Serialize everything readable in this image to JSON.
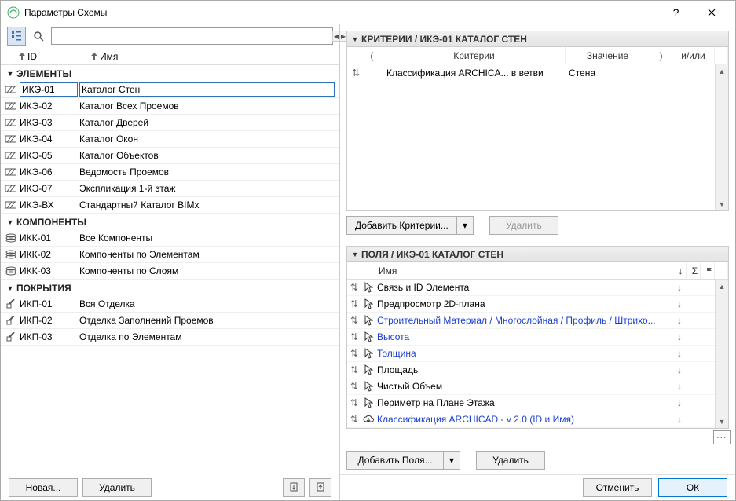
{
  "window": {
    "title": "Параметры Схемы"
  },
  "left": {
    "header": {
      "id": "ID",
      "name": "Имя"
    },
    "groups": [
      {
        "label": "ЭЛЕМЕНТЫ",
        "icon": "hatch",
        "items": [
          {
            "id": "ИКЭ-01",
            "name": "Каталог Стен",
            "selected": true
          },
          {
            "id": "ИКЭ-02",
            "name": "Каталог Всех Проемов"
          },
          {
            "id": "ИКЭ-03",
            "name": "Каталог Дверей"
          },
          {
            "id": "ИКЭ-04",
            "name": "Каталог Окон"
          },
          {
            "id": "ИКЭ-05",
            "name": "Каталог Объектов"
          },
          {
            "id": "ИКЭ-06",
            "name": "Ведомость Проемов"
          },
          {
            "id": "ИКЭ-07",
            "name": "Экспликация 1-й этаж"
          },
          {
            "id": "ИКЭ-ВХ",
            "name": "Стандартный Каталог BIMx"
          }
        ]
      },
      {
        "label": "КОМПОНЕНТЫ",
        "icon": "stack",
        "items": [
          {
            "id": "ИКК-01",
            "name": "Все Компоненты"
          },
          {
            "id": "ИКК-02",
            "name": "Компоненты по Элементам"
          },
          {
            "id": "ИКК-03",
            "name": "Компоненты по Слоям"
          }
        ]
      },
      {
        "label": "ПОКРЫТИЯ",
        "icon": "brush",
        "items": [
          {
            "id": "ИКП-01",
            "name": "Вся Отделка"
          },
          {
            "id": "ИКП-02",
            "name": "Отделка Заполнений Проемов"
          },
          {
            "id": "ИКП-03",
            "name": "Отделка по Элементам"
          }
        ]
      }
    ],
    "buttons": {
      "new": "Новая...",
      "delete": "Удалить"
    }
  },
  "right": {
    "criteria": {
      "title": "КРИТЕРИИ / ИКЭ-01 КАТАЛОГ СТЕН",
      "head": {
        "open": "(",
        "crit": "Критерии",
        "val": "Значение",
        "close": ")",
        "andor": "и/или"
      },
      "rows": [
        {
          "crit": "Классификация ARCHICA... в ветви",
          "val": "Стена"
        }
      ],
      "buttons": {
        "add": "Добавить Критерии...",
        "delete": "Удалить"
      }
    },
    "fields": {
      "title": "ПОЛЯ / ИКЭ-01 КАТАЛОГ СТЕН",
      "head": {
        "name": "Имя"
      },
      "rows": [
        {
          "name": "Связь и ID Элемента",
          "link": false,
          "icon": "pointer"
        },
        {
          "name": "Предпросмотр 2D-плана",
          "link": false,
          "icon": "pointer"
        },
        {
          "name": "Строительный Материал / Многослойная / Профиль / Штрихо...",
          "link": true,
          "icon": "pointer"
        },
        {
          "name": "Высота",
          "link": true,
          "icon": "pointer"
        },
        {
          "name": "Толщина",
          "link": true,
          "icon": "pointer"
        },
        {
          "name": "Площадь",
          "link": false,
          "icon": "pointer"
        },
        {
          "name": "Чистый Объем",
          "link": false,
          "icon": "pointer"
        },
        {
          "name": "Периметр на Плане Этажа",
          "link": false,
          "icon": "pointer"
        },
        {
          "name": "Классификация ARCHICAD - v 2.0 (ID и Имя)",
          "link": true,
          "icon": "cloud"
        }
      ],
      "buttons": {
        "add": "Добавить Поля...",
        "delete": "Удалить"
      }
    }
  },
  "footer": {
    "cancel": "Отменить",
    "ok": "ОК"
  }
}
